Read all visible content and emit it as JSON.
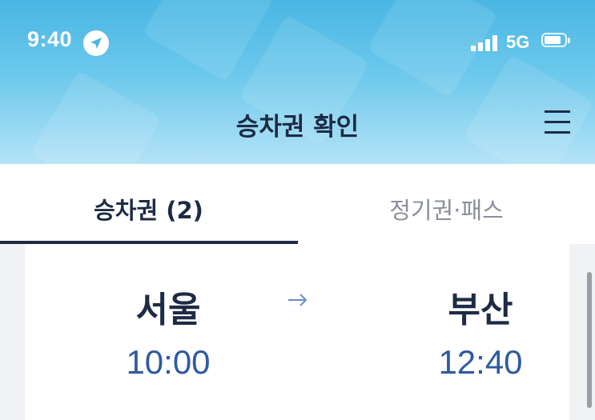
{
  "status_bar": {
    "time": "9:40",
    "network": "5G",
    "location_icon": "location-arrow-icon",
    "signal_icon": "cellular-signal-icon",
    "battery_icon": "battery-icon"
  },
  "header": {
    "title": "승차권 확인",
    "menu_icon": "hamburger-menu-icon"
  },
  "tabs": [
    {
      "label": "승차권 (2)",
      "active": true
    },
    {
      "label": "정기권·패스",
      "active": false
    }
  ],
  "ticket": {
    "departure_station": "서울",
    "departure_time": "10:00",
    "arrival_station": "부산",
    "arrival_time": "12:40",
    "arrow_icon": "right-arrow-icon"
  },
  "colors": {
    "header_gradient_top": "#49b6e3",
    "header_gradient_bottom": "#b4e3f6",
    "primary_text": "#1d2b44",
    "time_blue": "#2e5aa0",
    "inactive_tab": "#8a8f98",
    "background": "#f1f2f5"
  }
}
